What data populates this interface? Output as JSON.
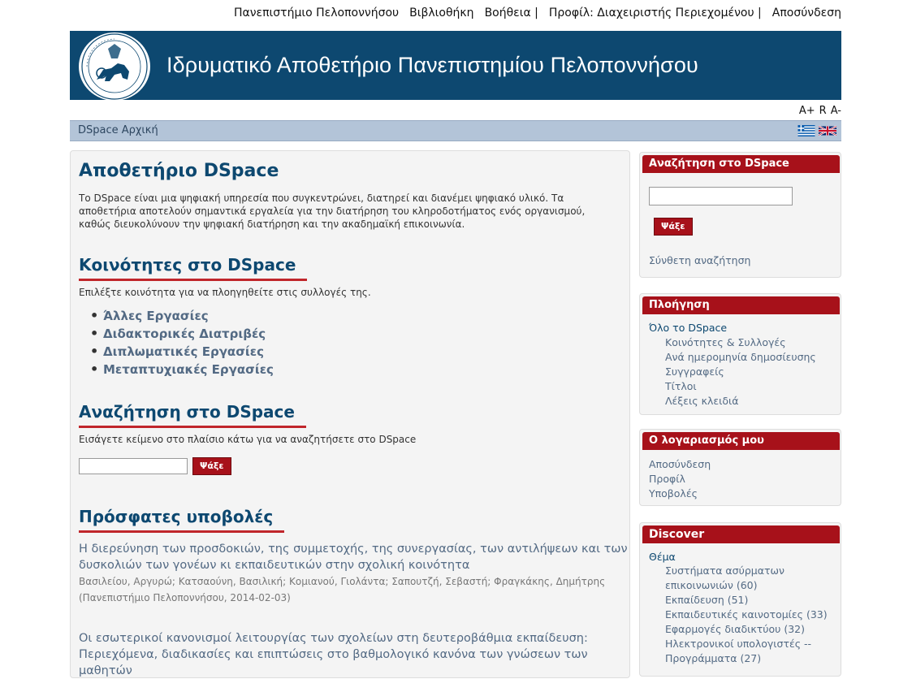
{
  "topnav": {
    "university": "Πανεπιστήμιο Πελοποννήσου",
    "library": "Βιβλιοθήκη",
    "help": "Βοήθεια |",
    "profile": "Προφίλ: Διαχειριστής Περιεχομένου |",
    "logout": "Αποσύνδεση"
  },
  "banner": {
    "title": "Ιδρυματικό Αποθετήριο Πανεπιστημίου Πελοποννήσου"
  },
  "font_controls": {
    "increase": "A+",
    "reset": "R",
    "decrease": "A-"
  },
  "breadcrumb": {
    "home": "DSpace Αρχική"
  },
  "main": {
    "title": "Αποθετήριο DSpace",
    "intro": "Το DSpace είναι μια ψηφιακή υπηρεσία που συγκεντρώνει, διατηρεί και διανέμει ψηφιακό υλικό. Τα αποθετήρια αποτελούν σημαντικά εργαλεία για την διατήρηση του κληροδοτήματος ενός οργανισμού, καθώς διευκολύνουν την ψηφιακή διατήρηση και την ακαδημαϊκή επικοινωνία.",
    "communities": {
      "heading": "Κοινότητες στο DSpace",
      "text": "Επιλέξτε κοινότητα για να πλοηγηθείτε στις συλλογές της.",
      "items": [
        "Άλλες Εργασίες",
        "Διδακτορικές Διατριβές",
        "Διπλωματικές Εργασίες",
        "Μεταπτυχιακές Εργασίες"
      ]
    },
    "search": {
      "heading": "Αναζήτηση στο DSpace",
      "text": "Εισάγετε κείμενο στο πλαίσιο κάτω για να αναζητήσετε στο DSpace",
      "value": "",
      "button": "Ψάξε"
    },
    "recent": {
      "heading": "Πρόσφατες υποβολές",
      "items": [
        {
          "title": "Η διερεύνηση των προσδοκιών, της συμμετοχής, της συνεργασίας, των αντιλήψεων και των δυσκολιών των γονέων κι εκπαιδευτικών στην σχολική κοινότητα",
          "authors": "Βασιλείου, Αργυρώ; Κατσαούνη, Βασιλική; Κομιανού, Γιολάντα; Σαπουτζή, Σεβαστή; Φραγκάκης, Δημήτρης",
          "source": "(Πανεπιστήμιο Πελοποννήσου, 2014-02-03)"
        },
        {
          "title": "Οι εσωτερικοί κανονισμοί λειτουργίας των σχολείων στη δευτεροβάθμια εκπαίδευση: Περιεχόμενα, διαδικασίες και επιπτώσεις στο βαθμολογικό κανόνα των γνώσεων των μαθητών",
          "authors": "",
          "source": ""
        }
      ]
    }
  },
  "sidebar": {
    "search": {
      "heading": "Αναζήτηση στο DSpace",
      "value": "",
      "button": "Ψάξε",
      "advanced": "Σύνθετη αναζήτηση"
    },
    "browse": {
      "heading": "Πλοήγηση",
      "all": "Όλο το DSpace",
      "items": [
        "Κοινότητες & Συλλογές",
        "Ανά ημερομηνία δημοσίευσης",
        "Συγγραφείς",
        "Τίτλοι",
        "Λέξεις κλειδιά"
      ]
    },
    "account": {
      "heading": "Ο λογαριασμός μου",
      "items": [
        "Αποσύνδεση",
        "Προφίλ",
        "Υποβολές"
      ]
    },
    "discover": {
      "heading": "Discover",
      "facet": "Θέμα",
      "items": [
        "Συστήματα ασύρματων επικοινωνιών (60)",
        "Εκπαίδευση (51)",
        "Εκπαιδευτικές καινοτομίες (33)",
        "Εφαρμογές διαδικτύου (32)",
        "Ηλεκτρονικοί υπολογιστές -- Προγράμματα (27)"
      ]
    }
  },
  "colors": {
    "banner": "#0d4870",
    "accent": "#a7111a",
    "link": "#536a84",
    "trail": "#b3c4d8"
  }
}
